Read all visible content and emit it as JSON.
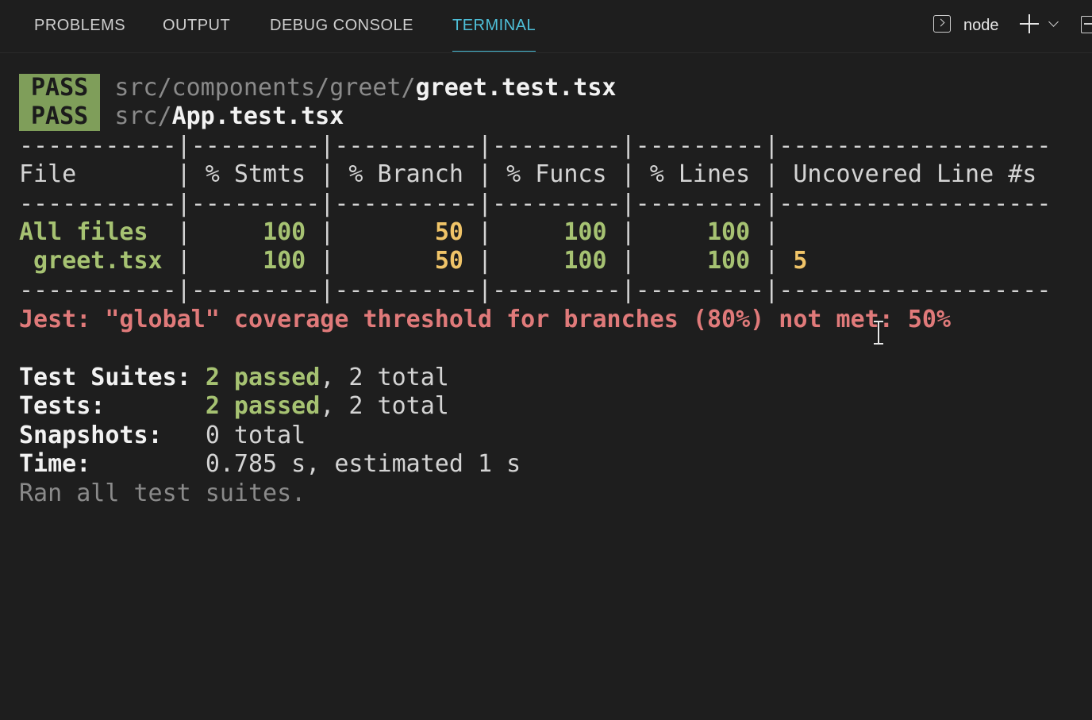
{
  "tabs": [
    {
      "label": "PROBLEMS"
    },
    {
      "label": "OUTPUT"
    },
    {
      "label": "DEBUG CONSOLE"
    },
    {
      "label": "TERMINAL",
      "active": true
    }
  ],
  "toolbar": {
    "terminal_icon": "terminal-icon",
    "shell_name": "node",
    "add_icon": "plus-icon",
    "dropdown_icon": "chevron-down-icon",
    "split_icon": "split-terminal-icon"
  },
  "results": [
    {
      "badge": "PASS",
      "path_dim": "src/components/greet/",
      "path_file": "greet.test.tsx"
    },
    {
      "badge": "PASS",
      "path_dim": "src/",
      "path_file": "App.test.tsx"
    }
  ],
  "coverage": {
    "separator": "-----------|---------|----------|---------|---------|-------------------",
    "header": "File       | % Stmts | % Branch | % Funcs | % Lines | Uncovered Line #s ",
    "rows": [
      {
        "file": "All files  ",
        "stmts": "100",
        "branch": "50",
        "funcs": "100",
        "lines": "100",
        "uncovered": ""
      },
      {
        "file": " greet.tsx ",
        "stmts": "100",
        "branch": "50",
        "funcs": "100",
        "lines": "100",
        "uncovered": "5"
      }
    ]
  },
  "threshold_error": "Jest: \"global\" coverage threshold for branches (80%) not met: 50%",
  "summary": {
    "suites_label": "Test Suites:",
    "suites_passed": "2 passed",
    "suites_total": ", 2 total",
    "tests_label": "Tests:",
    "tests_passed": "2 passed",
    "tests_total": ", 2 total",
    "snapshots_label": "Snapshots:",
    "snapshots_value": "0 total",
    "time_label": "Time:",
    "time_value": "0.785 s, estimated 1 s",
    "ran_all": "Ran all test suites."
  },
  "colors": {
    "background": "#1e1e1e",
    "active_tab": "#4ec0d9",
    "pass_badge": "#7f9e5a",
    "green": "#a6c272",
    "yellow": "#f0c468",
    "red": "#e07a7a"
  }
}
